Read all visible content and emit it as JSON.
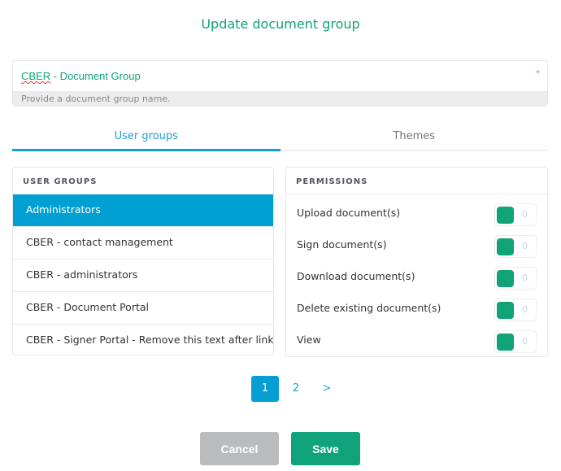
{
  "title": "Update document group",
  "name_field": {
    "value_prefix": "CBER",
    "value_rest": " - Document Group",
    "required_mark": "*",
    "hint": "Provide a document group name."
  },
  "tabs": [
    {
      "label": "User groups",
      "active": true
    },
    {
      "label": "Themes",
      "active": false
    }
  ],
  "user_groups": {
    "header": "USER GROUPS",
    "items": [
      "Administrators",
      "CBER - contact management",
      "CBER - administrators",
      "CBER - Document Portal",
      "CBER - Signer Portal - Remove this text after linking"
    ],
    "selected": 0
  },
  "permissions": {
    "header": "PERMISSIONS",
    "items": [
      {
        "label": "Upload document(s)",
        "toggle_label": "0"
      },
      {
        "label": "Sign document(s)",
        "toggle_label": "0"
      },
      {
        "label": "Download document(s)",
        "toggle_label": "0"
      },
      {
        "label": "Delete existing document(s)",
        "toggle_label": "0"
      },
      {
        "label": "View",
        "toggle_label": "0"
      }
    ]
  },
  "pagination": {
    "pages": [
      "1",
      "2"
    ],
    "next": ">",
    "current": "1"
  },
  "buttons": {
    "cancel": "Cancel",
    "save": "Save"
  }
}
